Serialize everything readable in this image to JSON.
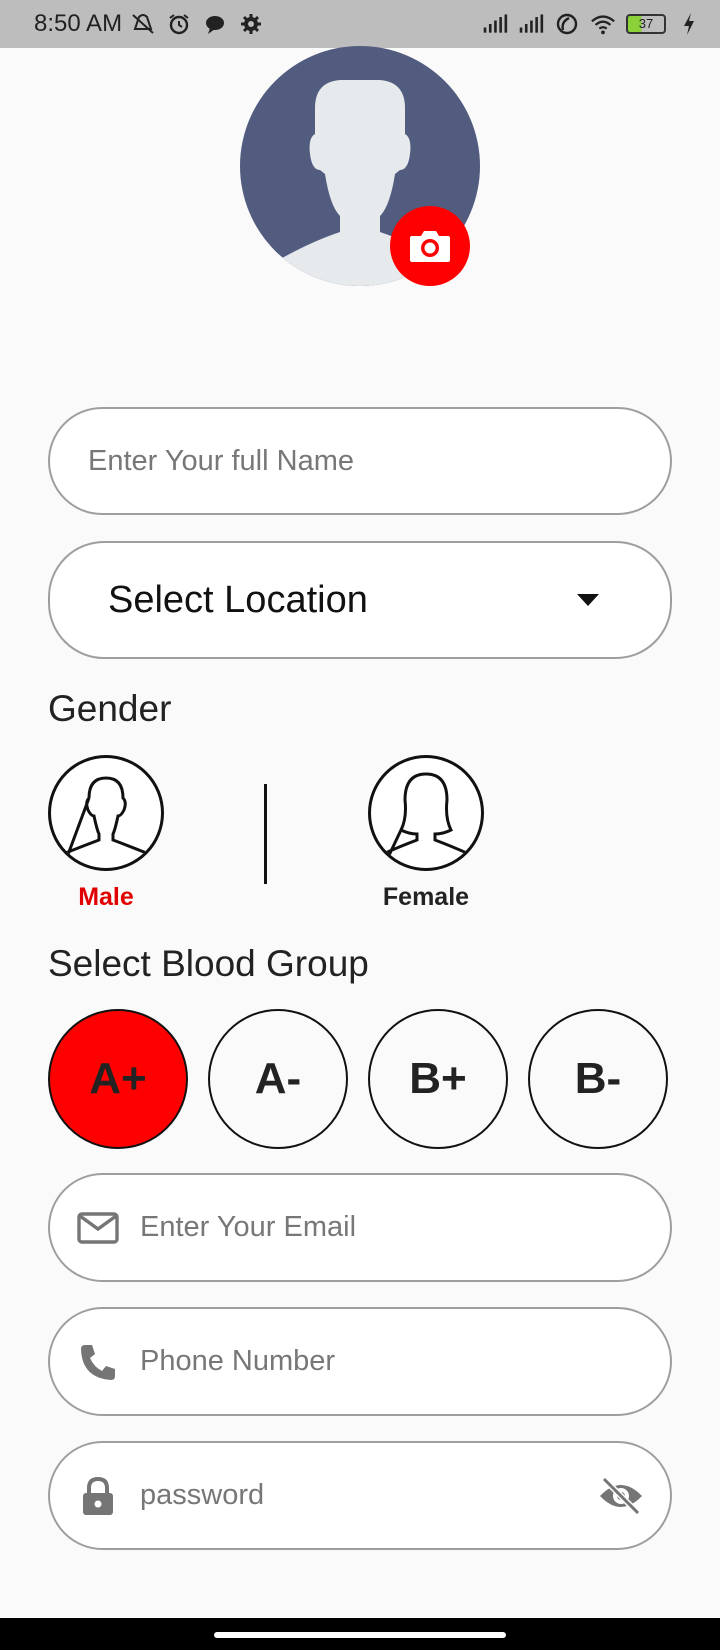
{
  "status_bar": {
    "time": "8:50 AM",
    "battery": "37",
    "icons_left": [
      "mute-icon",
      "alarm-icon",
      "chat-icon",
      "gear-icon"
    ],
    "icons_right": [
      "signal-icon",
      "signal-icon",
      "hotspot-icon",
      "wifi-icon",
      "battery-icon",
      "charging-icon"
    ]
  },
  "profile": {
    "avatar_icon": "person-silhouette-icon",
    "camera_icon": "camera-icon"
  },
  "form": {
    "name_placeholder": "Enter Your full Name",
    "location_label": "Select Location",
    "gender_heading": "Gender",
    "gender_options": [
      {
        "label": "Male",
        "selected": true
      },
      {
        "label": "Female",
        "selected": false
      }
    ],
    "blood_heading": "Select Blood Group",
    "blood_groups": [
      {
        "label": "A+",
        "selected": true
      },
      {
        "label": "A-",
        "selected": false
      },
      {
        "label": "B+",
        "selected": false
      },
      {
        "label": "B-",
        "selected": false
      }
    ],
    "email_placeholder": "Enter Your Email",
    "phone_placeholder": "Phone Number",
    "password_placeholder": "password"
  },
  "colors": {
    "accent": "#ff0000",
    "avatar_bg": "#525c7e",
    "selected_text": "#e00000"
  }
}
